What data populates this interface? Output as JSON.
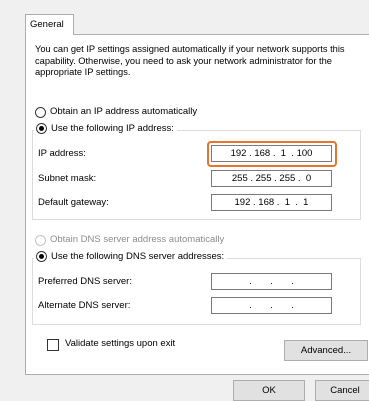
{
  "tab": {
    "label": "General"
  },
  "description": "You can get IP settings assigned automatically if your network supports this capability. Otherwise, you need to ask your network administrator for the appropriate IP settings.",
  "ip_mode": {
    "auto_label": "Obtain an IP address automatically",
    "manual_label": "Use the following IP address:",
    "selected": "manual"
  },
  "ip_fields": {
    "ip_address": {
      "label": "IP address:",
      "value": "192 . 168 .  1  . 100"
    },
    "subnet_mask": {
      "label": "Subnet mask:",
      "value": "255 . 255 . 255 .  0"
    },
    "default_gateway": {
      "label": "Default gateway:",
      "value": "192 . 168 .  1  .  1"
    }
  },
  "dns_mode": {
    "auto_label": "Obtain DNS server address automatically",
    "manual_label": "Use the following DNS server addresses:",
    "selected": "manual"
  },
  "dns_fields": {
    "preferred": {
      "label": "Preferred DNS server:",
      "value": ".       .       ."
    },
    "alternate": {
      "label": "Alternate DNS server:",
      "value": ".       .       ."
    }
  },
  "validate": {
    "label": "Validate settings upon exit",
    "checked": false
  },
  "buttons": {
    "advanced": "Advanced...",
    "ok": "OK",
    "cancel": "Cancel"
  },
  "colors": {
    "highlight": "#e8742b"
  }
}
